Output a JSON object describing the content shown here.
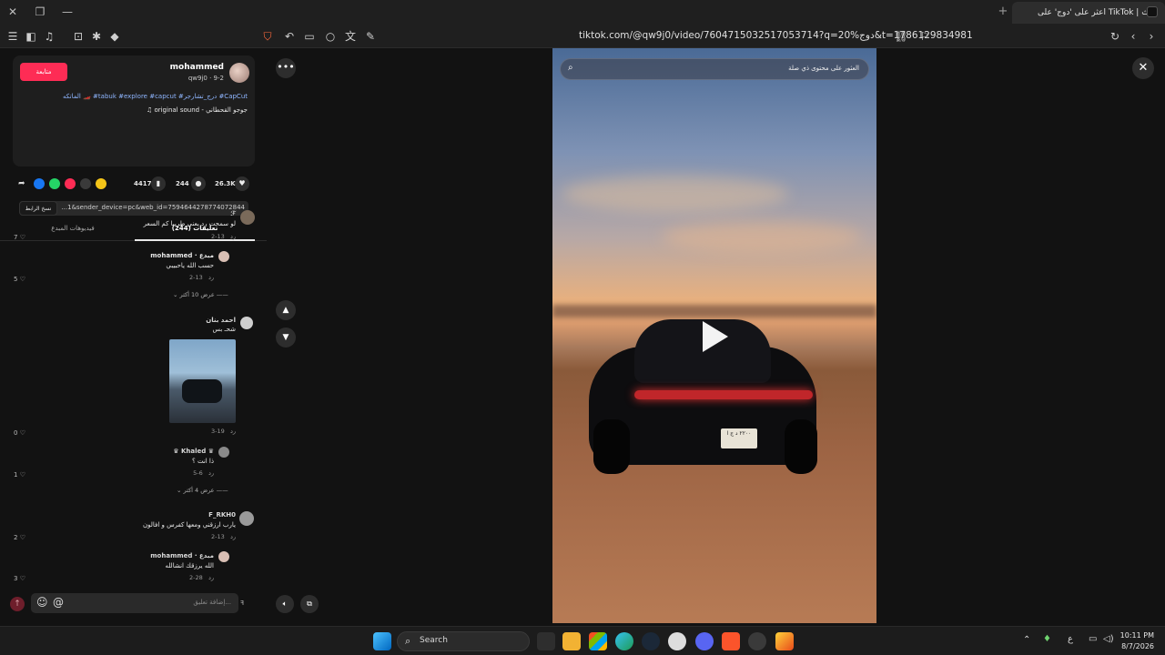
{
  "browser": {
    "tab_title": "اعثر على 'دوج' على TikTok | بحث",
    "url": "tiktok.com/@qw9j0/video/7604715032517053714?q=دوج%20&t=1786129834981"
  },
  "post": {
    "follow_label": "متابعة",
    "username": "mohammed",
    "handle_date": "qw9j0 · 9-2",
    "caption": "الماتكه 🏎️ #tabuk #explore #capcut #درج_تشارجر #CapCut",
    "sound": "♫ original sound - جوجو القحطاني",
    "likes": "26.3K",
    "comments": "244",
    "saves": "4417",
    "copy_link_label": "نسخ الرابط",
    "link_text": "...1&sender_device=pc&web_id=7594644278774072844",
    "tab_comments": "تعليقات (244)",
    "tab_creator_videos": "فيديوهات المبدع"
  },
  "comments": [
    {
      "name": "ℱ",
      "text": "لو سمحت رد يعني طربيا كم السعر",
      "date": "2-13",
      "reply": "رد",
      "likes": "7"
    },
    {
      "name": "mohammed · مبدع",
      "text": "حسب الله ياحبيبي",
      "date": "2-13",
      "reply": "رد",
      "likes": "5",
      "more": "عرض 10 أكثر"
    },
    {
      "name": "احمد بنان",
      "text": "شحـ بس",
      "date": "3-19",
      "reply": "رد",
      "likes": "0"
    },
    {
      "name": "♛ Khaled ♛",
      "text": "ذا انت ؟",
      "date": "5-6",
      "reply": "رد",
      "likes": "1",
      "more": "عرض 4 أكثر"
    },
    {
      "name": "F_RKH0",
      "text": "يارب ارزقني ومعها كفرس و افالون",
      "date": "2-13",
      "reply": "رد",
      "likes": "2"
    },
    {
      "name": "mohammed · مبدع",
      "text": "الله يرزقك انشالله",
      "date": "2-28",
      "reply": "رد",
      "likes": "3"
    }
  ],
  "comment_input_placeholder": "إضافة تعليق...",
  "video": {
    "search_placeholder": "العثور على محتوى ذي صلة",
    "plate_text": "٢٢٠٠ د ج ا"
  },
  "taskbar": {
    "search_label": "Search",
    "time": "10:11 PM",
    "date": "8/7/2026",
    "lang": "ع"
  },
  "colors": {
    "accent": "#fe2c55",
    "link": "#8fb6ff"
  }
}
